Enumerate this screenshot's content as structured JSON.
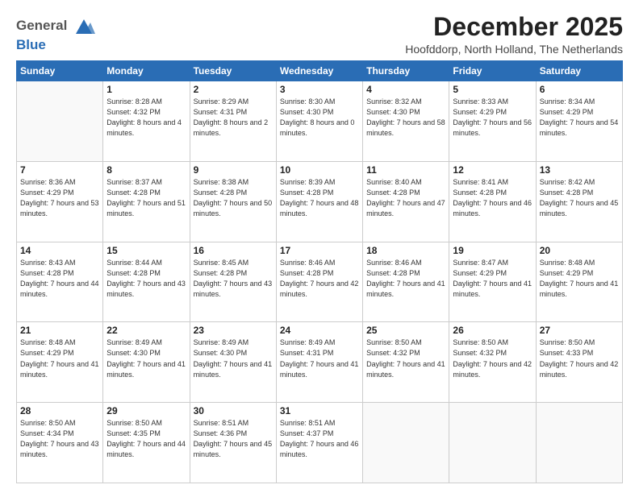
{
  "header": {
    "logo_line1": "General",
    "logo_line2": "Blue",
    "main_title": "December 2025",
    "subtitle": "Hoofddorp, North Holland, The Netherlands"
  },
  "calendar": {
    "days_of_week": [
      "Sunday",
      "Monday",
      "Tuesday",
      "Wednesday",
      "Thursday",
      "Friday",
      "Saturday"
    ],
    "weeks": [
      [
        {
          "day": "",
          "sunrise": "",
          "sunset": "",
          "daylight": ""
        },
        {
          "day": "1",
          "sunrise": "Sunrise: 8:28 AM",
          "sunset": "Sunset: 4:32 PM",
          "daylight": "Daylight: 8 hours and 4 minutes."
        },
        {
          "day": "2",
          "sunrise": "Sunrise: 8:29 AM",
          "sunset": "Sunset: 4:31 PM",
          "daylight": "Daylight: 8 hours and 2 minutes."
        },
        {
          "day": "3",
          "sunrise": "Sunrise: 8:30 AM",
          "sunset": "Sunset: 4:30 PM",
          "daylight": "Daylight: 8 hours and 0 minutes."
        },
        {
          "day": "4",
          "sunrise": "Sunrise: 8:32 AM",
          "sunset": "Sunset: 4:30 PM",
          "daylight": "Daylight: 7 hours and 58 minutes."
        },
        {
          "day": "5",
          "sunrise": "Sunrise: 8:33 AM",
          "sunset": "Sunset: 4:29 PM",
          "daylight": "Daylight: 7 hours and 56 minutes."
        },
        {
          "day": "6",
          "sunrise": "Sunrise: 8:34 AM",
          "sunset": "Sunset: 4:29 PM",
          "daylight": "Daylight: 7 hours and 54 minutes."
        }
      ],
      [
        {
          "day": "7",
          "sunrise": "Sunrise: 8:36 AM",
          "sunset": "Sunset: 4:29 PM",
          "daylight": "Daylight: 7 hours and 53 minutes."
        },
        {
          "day": "8",
          "sunrise": "Sunrise: 8:37 AM",
          "sunset": "Sunset: 4:28 PM",
          "daylight": "Daylight: 7 hours and 51 minutes."
        },
        {
          "day": "9",
          "sunrise": "Sunrise: 8:38 AM",
          "sunset": "Sunset: 4:28 PM",
          "daylight": "Daylight: 7 hours and 50 minutes."
        },
        {
          "day": "10",
          "sunrise": "Sunrise: 8:39 AM",
          "sunset": "Sunset: 4:28 PM",
          "daylight": "Daylight: 7 hours and 48 minutes."
        },
        {
          "day": "11",
          "sunrise": "Sunrise: 8:40 AM",
          "sunset": "Sunset: 4:28 PM",
          "daylight": "Daylight: 7 hours and 47 minutes."
        },
        {
          "day": "12",
          "sunrise": "Sunrise: 8:41 AM",
          "sunset": "Sunset: 4:28 PM",
          "daylight": "Daylight: 7 hours and 46 minutes."
        },
        {
          "day": "13",
          "sunrise": "Sunrise: 8:42 AM",
          "sunset": "Sunset: 4:28 PM",
          "daylight": "Daylight: 7 hours and 45 minutes."
        }
      ],
      [
        {
          "day": "14",
          "sunrise": "Sunrise: 8:43 AM",
          "sunset": "Sunset: 4:28 PM",
          "daylight": "Daylight: 7 hours and 44 minutes."
        },
        {
          "day": "15",
          "sunrise": "Sunrise: 8:44 AM",
          "sunset": "Sunset: 4:28 PM",
          "daylight": "Daylight: 7 hours and 43 minutes."
        },
        {
          "day": "16",
          "sunrise": "Sunrise: 8:45 AM",
          "sunset": "Sunset: 4:28 PM",
          "daylight": "Daylight: 7 hours and 43 minutes."
        },
        {
          "day": "17",
          "sunrise": "Sunrise: 8:46 AM",
          "sunset": "Sunset: 4:28 PM",
          "daylight": "Daylight: 7 hours and 42 minutes."
        },
        {
          "day": "18",
          "sunrise": "Sunrise: 8:46 AM",
          "sunset": "Sunset: 4:28 PM",
          "daylight": "Daylight: 7 hours and 41 minutes."
        },
        {
          "day": "19",
          "sunrise": "Sunrise: 8:47 AM",
          "sunset": "Sunset: 4:29 PM",
          "daylight": "Daylight: 7 hours and 41 minutes."
        },
        {
          "day": "20",
          "sunrise": "Sunrise: 8:48 AM",
          "sunset": "Sunset: 4:29 PM",
          "daylight": "Daylight: 7 hours and 41 minutes."
        }
      ],
      [
        {
          "day": "21",
          "sunrise": "Sunrise: 8:48 AM",
          "sunset": "Sunset: 4:29 PM",
          "daylight": "Daylight: 7 hours and 41 minutes."
        },
        {
          "day": "22",
          "sunrise": "Sunrise: 8:49 AM",
          "sunset": "Sunset: 4:30 PM",
          "daylight": "Daylight: 7 hours and 41 minutes."
        },
        {
          "day": "23",
          "sunrise": "Sunrise: 8:49 AM",
          "sunset": "Sunset: 4:30 PM",
          "daylight": "Daylight: 7 hours and 41 minutes."
        },
        {
          "day": "24",
          "sunrise": "Sunrise: 8:49 AM",
          "sunset": "Sunset: 4:31 PM",
          "daylight": "Daylight: 7 hours and 41 minutes."
        },
        {
          "day": "25",
          "sunrise": "Sunrise: 8:50 AM",
          "sunset": "Sunset: 4:32 PM",
          "daylight": "Daylight: 7 hours and 41 minutes."
        },
        {
          "day": "26",
          "sunrise": "Sunrise: 8:50 AM",
          "sunset": "Sunset: 4:32 PM",
          "daylight": "Daylight: 7 hours and 42 minutes."
        },
        {
          "day": "27",
          "sunrise": "Sunrise: 8:50 AM",
          "sunset": "Sunset: 4:33 PM",
          "daylight": "Daylight: 7 hours and 42 minutes."
        }
      ],
      [
        {
          "day": "28",
          "sunrise": "Sunrise: 8:50 AM",
          "sunset": "Sunset: 4:34 PM",
          "daylight": "Daylight: 7 hours and 43 minutes."
        },
        {
          "day": "29",
          "sunrise": "Sunrise: 8:50 AM",
          "sunset": "Sunset: 4:35 PM",
          "daylight": "Daylight: 7 hours and 44 minutes."
        },
        {
          "day": "30",
          "sunrise": "Sunrise: 8:51 AM",
          "sunset": "Sunset: 4:36 PM",
          "daylight": "Daylight: 7 hours and 45 minutes."
        },
        {
          "day": "31",
          "sunrise": "Sunrise: 8:51 AM",
          "sunset": "Sunset: 4:37 PM",
          "daylight": "Daylight: 7 hours and 46 minutes."
        },
        {
          "day": "",
          "sunrise": "",
          "sunset": "",
          "daylight": ""
        },
        {
          "day": "",
          "sunrise": "",
          "sunset": "",
          "daylight": ""
        },
        {
          "day": "",
          "sunrise": "",
          "sunset": "",
          "daylight": ""
        }
      ]
    ]
  }
}
